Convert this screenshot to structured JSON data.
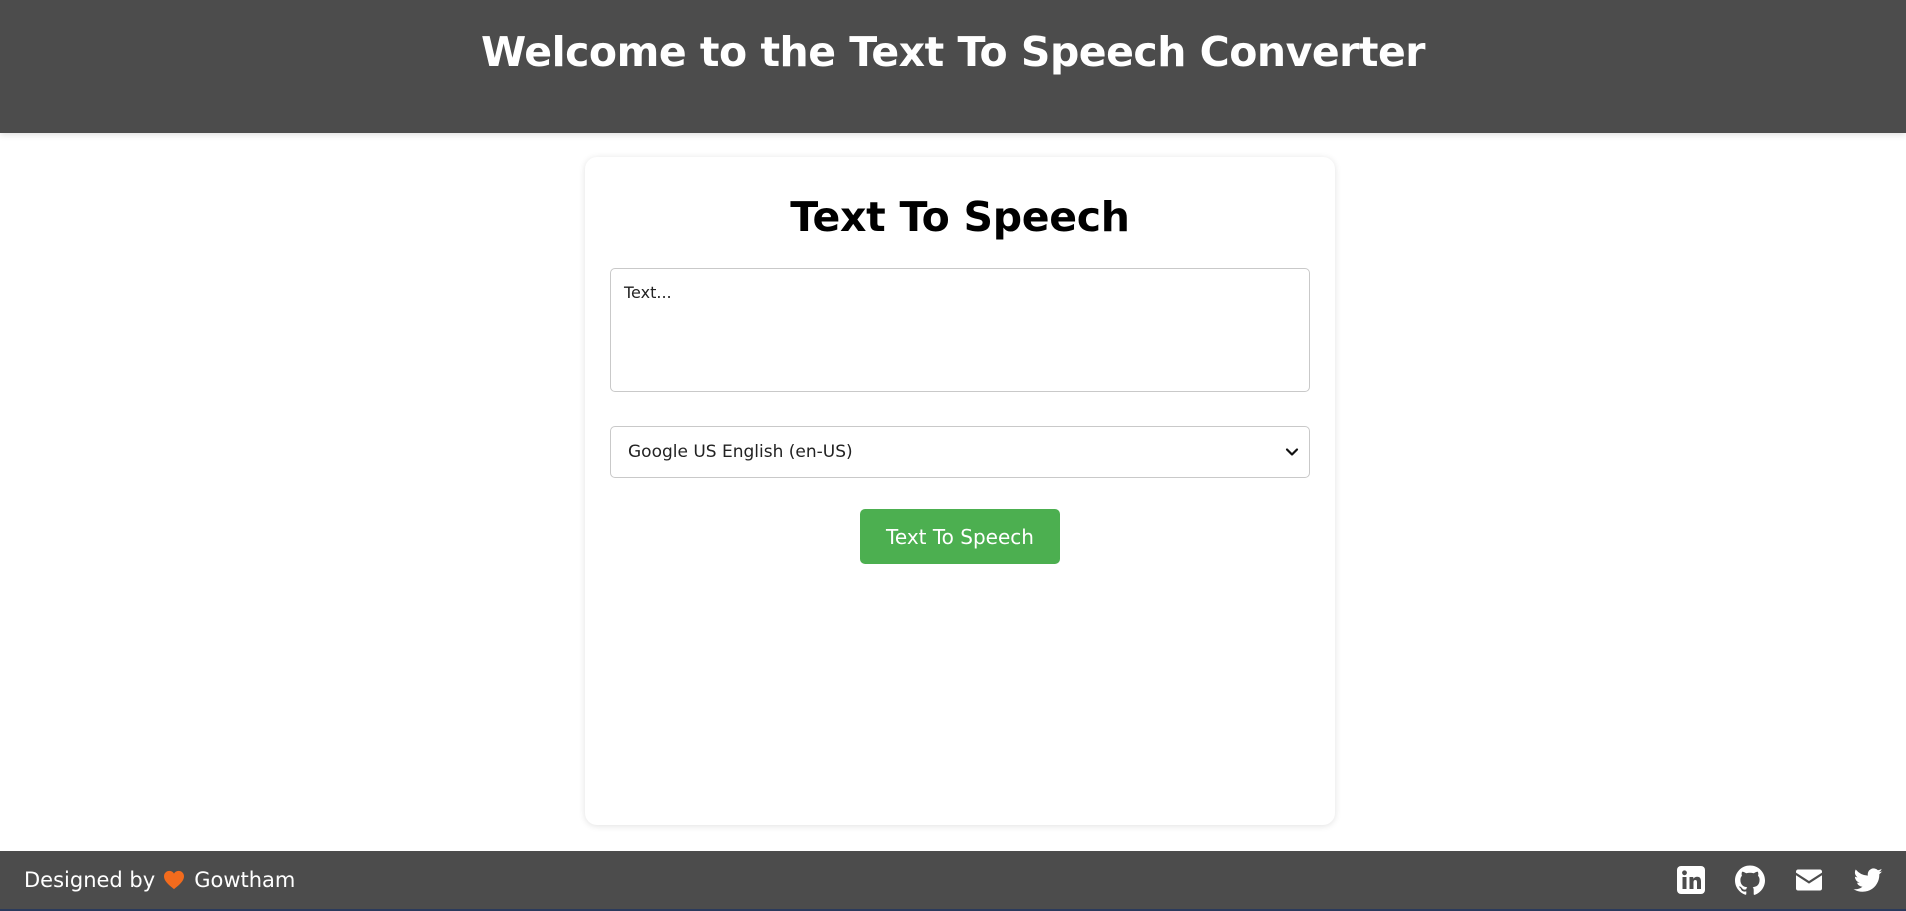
{
  "header": {
    "title": "Welcome to the Text To Speech Converter"
  },
  "card": {
    "title": "Text To Speech",
    "text_input": {
      "placeholder": "Text...",
      "value": ""
    },
    "voice_select": {
      "selected": "Google US English (en-US)"
    },
    "speak_button_label": "Text To Speech"
  },
  "footer": {
    "credit_prefix": "Designed by",
    "credit_name": "Gowtham",
    "heart_icon": "heart-icon",
    "heart_color": "#f26b1d",
    "social_icons": [
      "linkedin-icon",
      "github-icon",
      "email-icon",
      "twitter-icon"
    ]
  },
  "colors": {
    "header_bg": "#4c4c4c",
    "footer_bg": "#4c4c4c",
    "button_bg": "#4caf50",
    "button_text": "#ffffff"
  }
}
